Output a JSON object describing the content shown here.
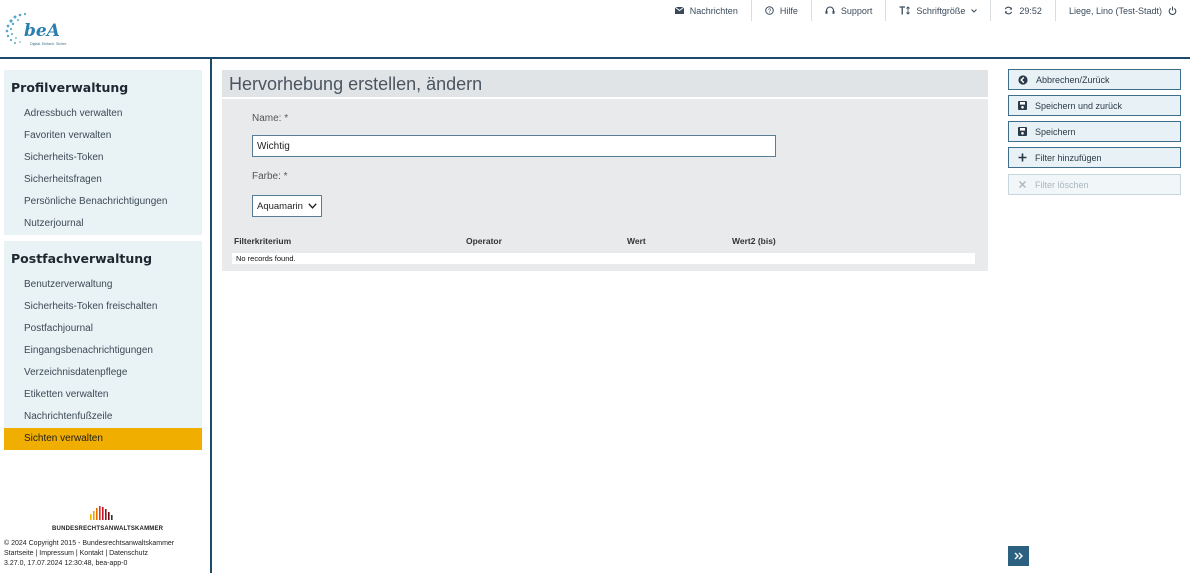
{
  "logo": {
    "text": "beA",
    "tagline": "Digital. Einfach. Sicher."
  },
  "topnav": {
    "messages": "Nachrichten",
    "help": "Hilfe",
    "support": "Support",
    "font_size": "Schriftgröße",
    "timer": "29:52",
    "user": "Liege, Lino (Test-Stadt)"
  },
  "sidebar": {
    "profile": {
      "title": "Profilverwaltung",
      "items": [
        "Adressbuch verwalten",
        "Favoriten verwalten",
        "Sicherheits-Token",
        "Sicherheitsfragen",
        "Persönliche Benachrichtigungen",
        "Nutzerjournal"
      ]
    },
    "mailbox": {
      "title": "Postfachverwaltung",
      "items": [
        "Benutzerverwaltung",
        "Sicherheits-Token freischalten",
        "Postfachjournal",
        "Eingangsbenachrichtigungen",
        "Verzeichnisdatenpflege",
        "Etiketten verwalten",
        "Nachrichtenfußzeile",
        "Sichten verwalten"
      ],
      "active_index": 7
    },
    "brak_name": "BUNDESRECHTSANWALTSKAMMER",
    "copyright": "© 2024 Copyright 2015 - Bundesrechtsanwaltskammer",
    "links": [
      "Startseite",
      "Impressum",
      "Kontakt",
      "Datenschutz"
    ],
    "version": "3.27.0, 17.07.2024 12:30:48, bea-app-0"
  },
  "form": {
    "title": "Hervorhebung erstellen, ändern",
    "name_label": "Name: *",
    "name_value": "Wichtig",
    "color_label": "Farbe: *",
    "color_value": "Aquamarin",
    "table": {
      "headers": [
        "Filterkriterium",
        "Operator",
        "Wert",
        "Wert2 (bis)"
      ],
      "empty": "No records found."
    }
  },
  "actions": {
    "cancel": "Abbrechen/Zurück",
    "save_back": "Speichern und zurück",
    "save": "Speichern",
    "add_filter": "Filter hinzufügen",
    "delete_filter": "Filter löschen"
  },
  "colors": {
    "accent": "#f0ae00",
    "brand": "#1b4a6a",
    "panel": "#e9f2f5",
    "button_dark": "#2c6080"
  }
}
